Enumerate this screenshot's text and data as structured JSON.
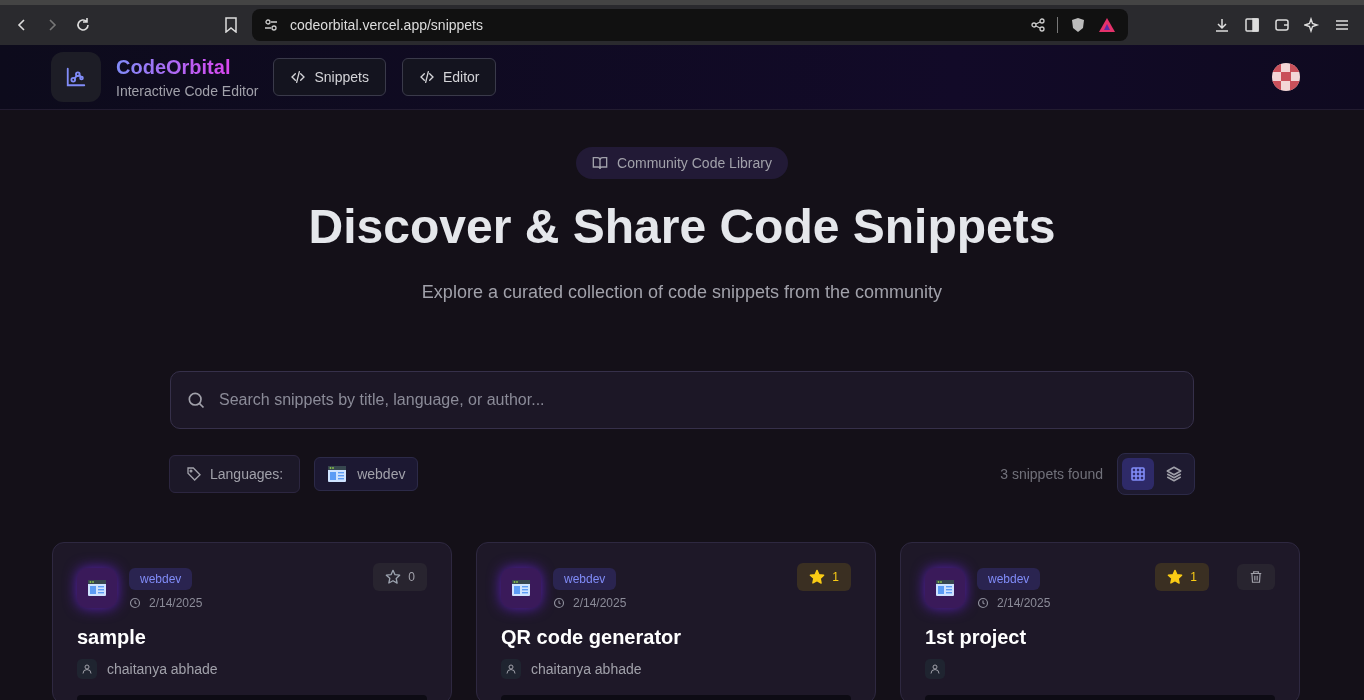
{
  "browser": {
    "url": "codeorbital.vercel.app/snippets"
  },
  "header": {
    "brand": "CodeOrbital",
    "tagline": "Interactive Code Editor",
    "nav": [
      {
        "label": "Snippets"
      },
      {
        "label": "Editor"
      }
    ]
  },
  "hero": {
    "badge": "Community Code Library",
    "title": "Discover & Share Code Snippets",
    "subtitle": "Explore a curated collection of code snippets from the community"
  },
  "search": {
    "placeholder": "Search snippets by title, language, or author..."
  },
  "filters": {
    "label": "Languages:",
    "languages": [
      {
        "label": "webdev"
      }
    ],
    "count": "3 snippets found",
    "views": [
      {
        "kind": "grid",
        "selected": true
      },
      {
        "kind": "stack",
        "selected": false
      }
    ]
  },
  "snippets": [
    {
      "language": "webdev",
      "date": "2/14/2025",
      "title": "sample",
      "author": "chaitanya abhade",
      "starred": false,
      "stars_count": "0",
      "deletable": false
    },
    {
      "language": "webdev",
      "date": "2/14/2025",
      "title": "QR code generator",
      "author": "chaitanya abhade",
      "starred": true,
      "stars_count": "1",
      "deletable": false
    },
    {
      "language": "webdev",
      "date": "2/14/2025",
      "title": "1st project",
      "starred": true,
      "stars_count": "1",
      "deletable": true
    }
  ]
}
